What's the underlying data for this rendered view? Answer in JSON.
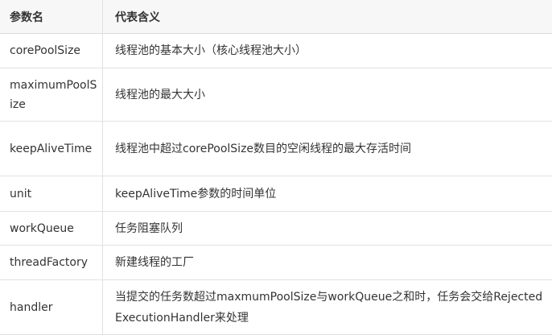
{
  "table": {
    "headers": [
      "参数名",
      "代表含义"
    ],
    "rows": [
      {
        "name": "corePoolSize",
        "desc": "线程池的基本大小（核心线程池大小）"
      },
      {
        "name": "maximumPoolSize",
        "desc": "线程池的最大大小"
      },
      {
        "name": "keepAliveTime",
        "desc": "线程池中超过corePoolSize数目的空闲线程的最大存活时间"
      },
      {
        "name": "unit",
        "desc": "keepAliveTime参数的时间单位"
      },
      {
        "name": "workQueue",
        "desc": "任务阻塞队列"
      },
      {
        "name": "threadFactory",
        "desc": "新建线程的工厂"
      },
      {
        "name": "handler",
        "desc": "当提交的任务数超过maxmumPoolSize与workQueue之和时，任务会交给RejectedExecutionHandler来处理"
      }
    ]
  }
}
